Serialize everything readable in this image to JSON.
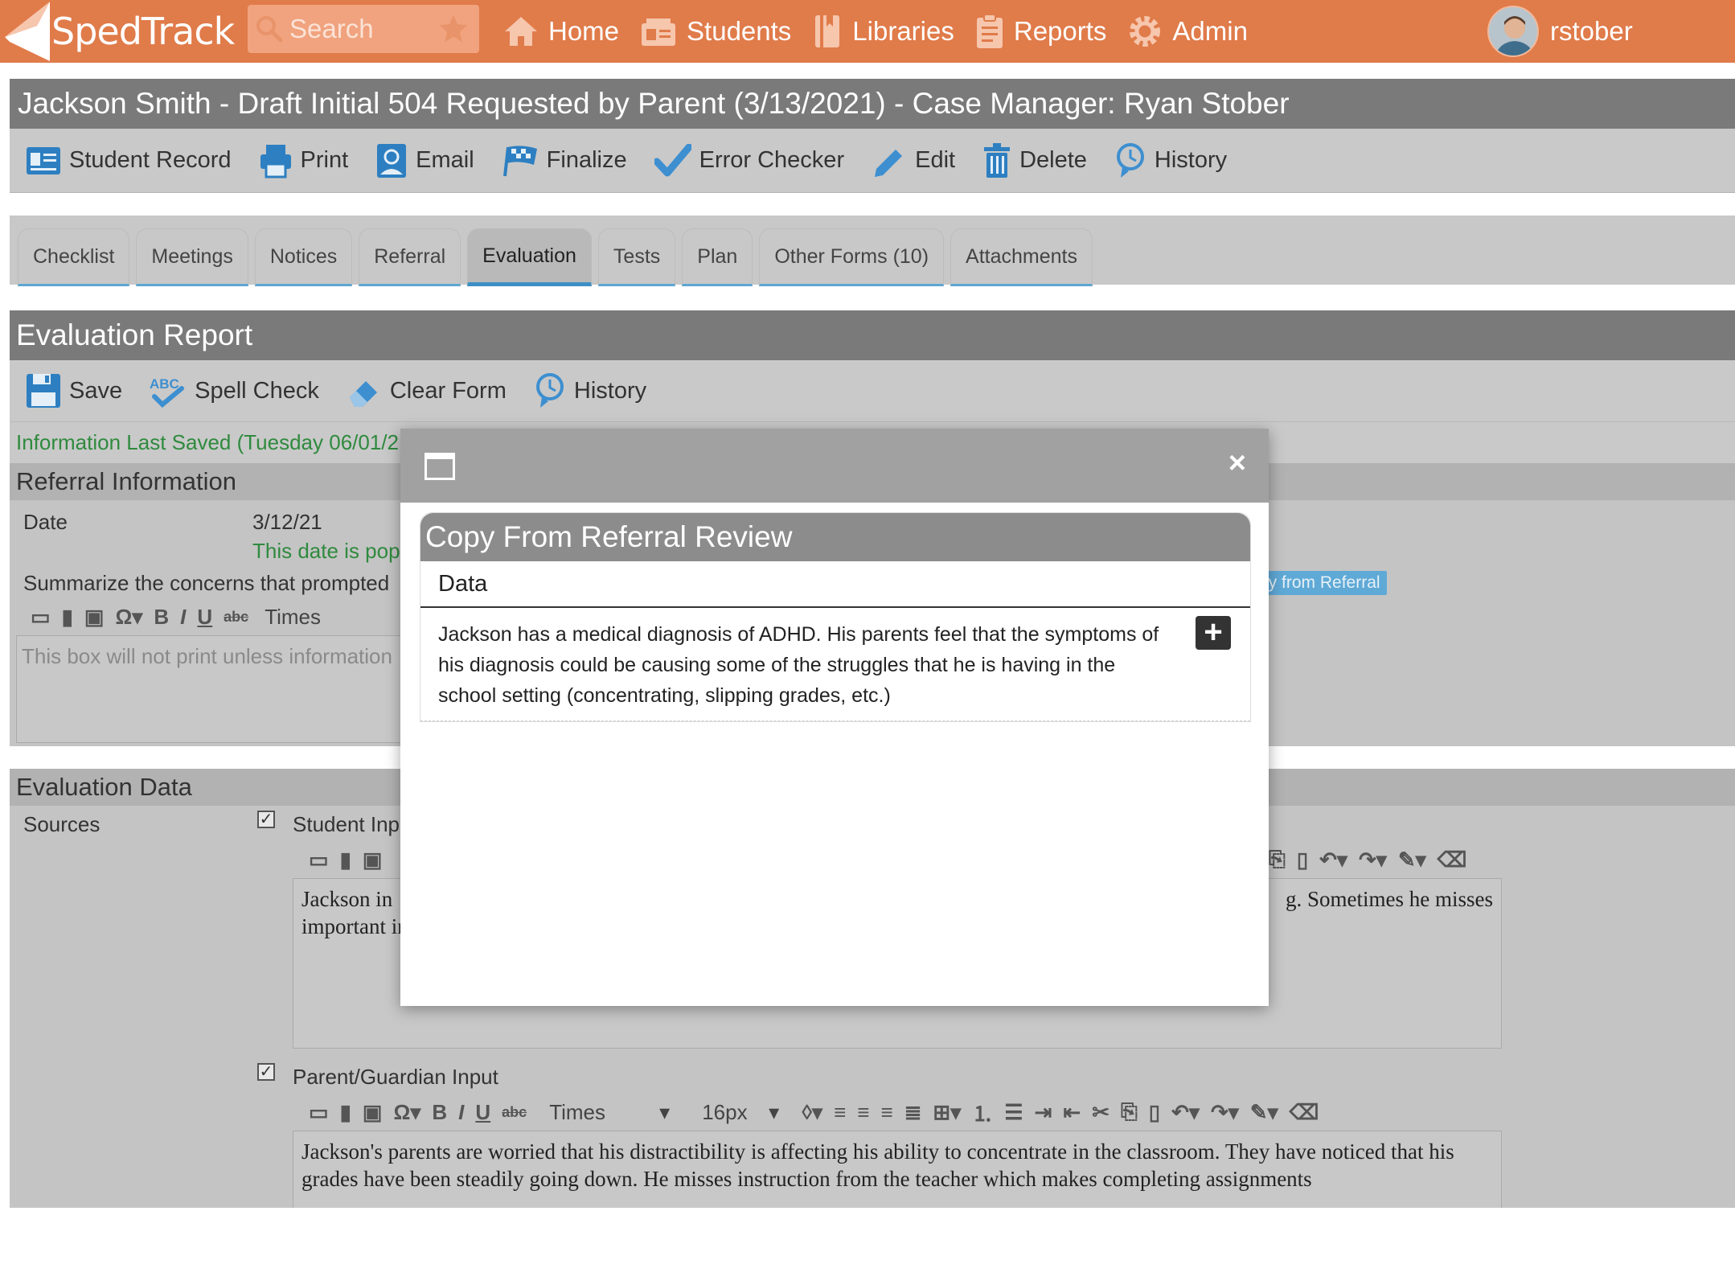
{
  "nav": {
    "brand": "SpedTrack",
    "search_placeholder": "Search",
    "links": [
      {
        "label": "Home",
        "icon": "home-icon"
      },
      {
        "label": "Students",
        "icon": "students-icon"
      },
      {
        "label": "Libraries",
        "icon": "libraries-icon"
      },
      {
        "label": "Reports",
        "icon": "reports-icon"
      },
      {
        "label": "Admin",
        "icon": "admin-gear-icon"
      }
    ],
    "username": "rstober"
  },
  "page": {
    "title": "Jackson Smith - Draft Initial 504 Requested by Parent (3/13/2021) - Case Manager: Ryan Stober",
    "actions": [
      "Student Record",
      "Print",
      "Email",
      "Finalize",
      "Error Checker",
      "Edit",
      "Delete",
      "History"
    ],
    "tabs": [
      "Checklist",
      "Meetings",
      "Notices",
      "Referral",
      "Evaluation",
      "Tests",
      "Plan",
      "Other Forms (10)",
      "Attachments"
    ],
    "active_tab": "Evaluation"
  },
  "report": {
    "title": "Evaluation Report",
    "actions": [
      "Save",
      "Spell Check",
      "Clear Form",
      "History"
    ],
    "last_saved": "Information Last Saved (Tuesday 06/01/2",
    "referral": {
      "header": "Referral Information",
      "date_label": "Date",
      "date_value": "3/12/21",
      "date_note": "This date is pop",
      "summarize_label": "Summarize the concerns that prompted",
      "copy_button": "py from Referral",
      "editor_font": "Times",
      "editor_placeholder": "This box will not print unless information"
    },
    "evaluation": {
      "header": "Evaluation Data",
      "sources_label": "Sources",
      "student_input_label": "Student Inp",
      "student_text_line1_left": "Jackson in",
      "student_text_line1_right": "g. Sometimes he misses",
      "student_text_line2": "important information during instruction which has a negative impact on his classroom performance.",
      "parent_input_label": "Parent/Guardian Input",
      "parent_font": "Times",
      "parent_size": "16px",
      "parent_text": "Jackson's parents are worried that his distractibility is affecting his ability to concentrate in the classroom. They have noticed that his grades have been steadily going down. He misses instruction from the teacher which makes completing assignments"
    }
  },
  "modal": {
    "panel_title": "Copy From Referral Review",
    "column_header": "Data",
    "row_text": "Jackson has a medical diagnosis of ADHD. His parents feel that the symptoms of his diagnosis could be causing some of the struggles that he is having in the school setting (concentrating, slipping grades, etc.)",
    "close_label": "×",
    "add_label": "+"
  },
  "colors": {
    "brand_orange": "#e07b4a",
    "link_blue": "#3e8fc5",
    "success_green": "#2f8a3e"
  }
}
